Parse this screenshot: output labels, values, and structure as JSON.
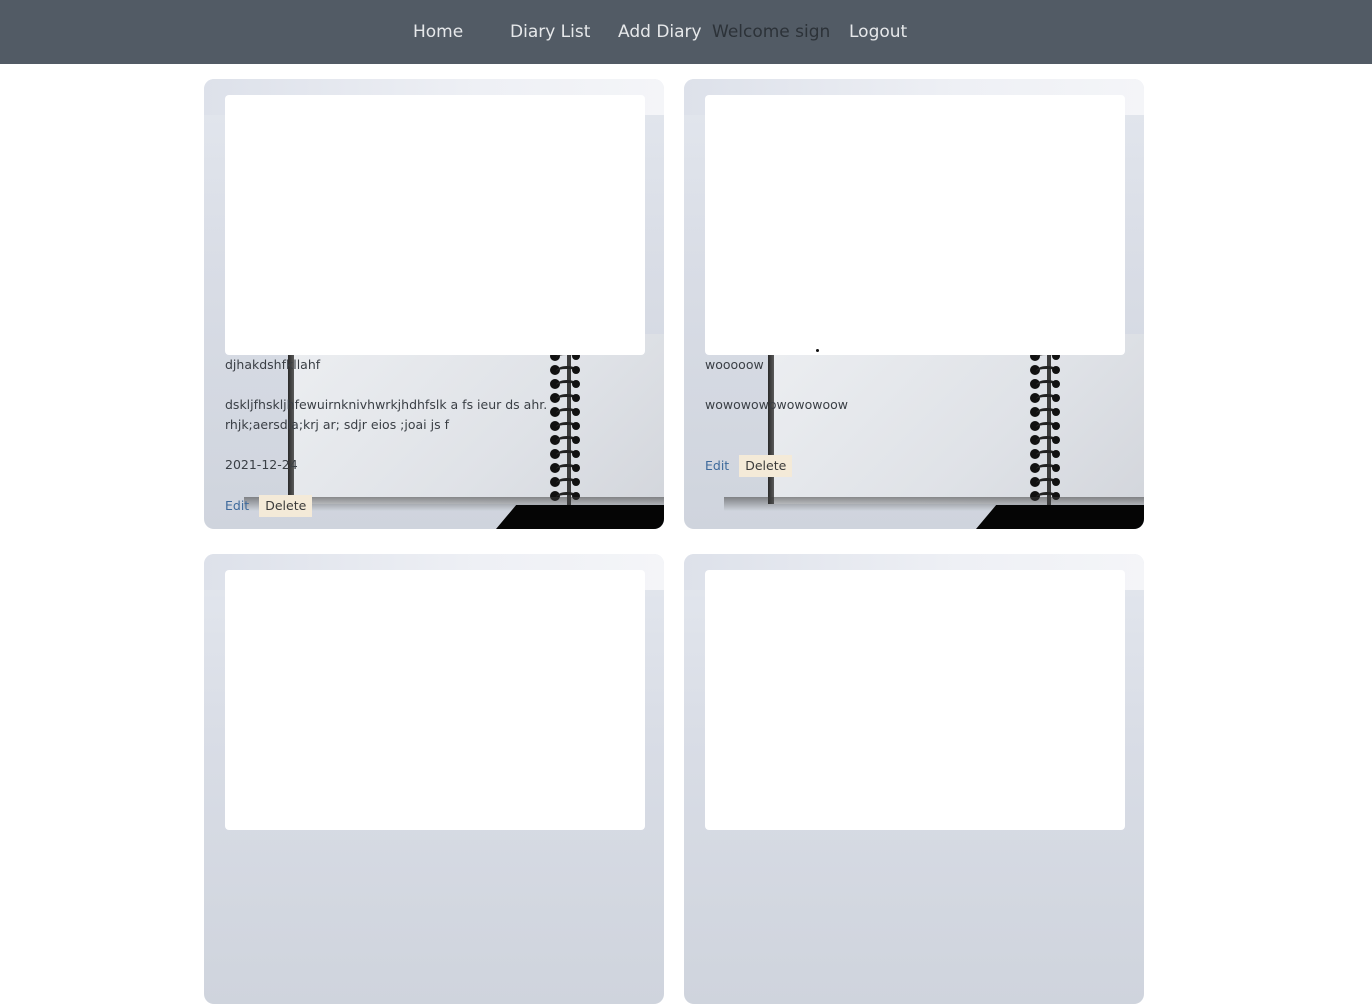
{
  "nav": {
    "home": "Home",
    "diary_list": "Diary List",
    "add_diary": "Add Diary",
    "welcome": "Welcome sign",
    "logout": "Logout"
  },
  "entries": [
    {
      "title": "djhakdshfkllahf",
      "content": "dskljfhskljhfewuirnknivhwrkjhdhfslk a fs ieur ds ahr. rhjk;aersdla;krj ar; sdjr eios ;joai js f",
      "date": "2021-12-24",
      "edit_label": "Edit",
      "delete_label": "Delete"
    },
    {
      "title": "wooooow",
      "content": "wowowowowowowoow",
      "date": "",
      "edit_label": "Edit",
      "delete_label": "Delete"
    }
  ],
  "colors": {
    "nav_bg": "#525b65",
    "edit_link": "#3e6a9c",
    "delete_bg": "#f4ead8"
  }
}
